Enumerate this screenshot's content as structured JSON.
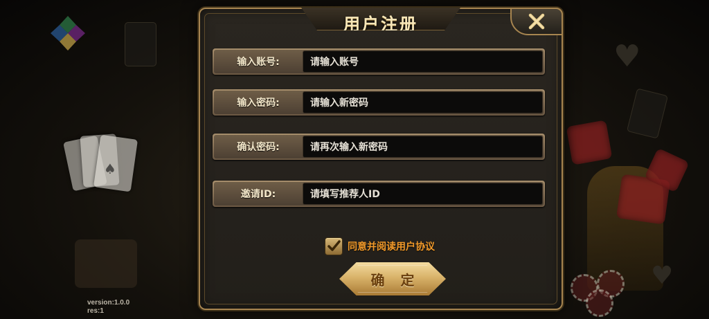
{
  "dialog": {
    "title": "用户注册",
    "close_icon": "close-icon"
  },
  "form": {
    "rows": [
      {
        "label": "输入账号:",
        "placeholder": "请输入账号"
      },
      {
        "label": "输入密码:",
        "placeholder": "请输入新密码"
      },
      {
        "label": "确认密码:",
        "placeholder": "请再次输入新密码"
      },
      {
        "label": "邀请ID:",
        "placeholder": "请填写推荐人ID"
      }
    ],
    "agreement": {
      "checked": true,
      "text": "同意并阅读用户协议"
    },
    "confirm_label": "确 定"
  },
  "footer": {
    "version": "version:1.0.0",
    "res": "res:1"
  },
  "colors": {
    "title_gold": "#f6e6b8",
    "frame_gold": "#a78550",
    "agree_orange": "#f29a2a",
    "button_gold": "#d9b36a"
  }
}
